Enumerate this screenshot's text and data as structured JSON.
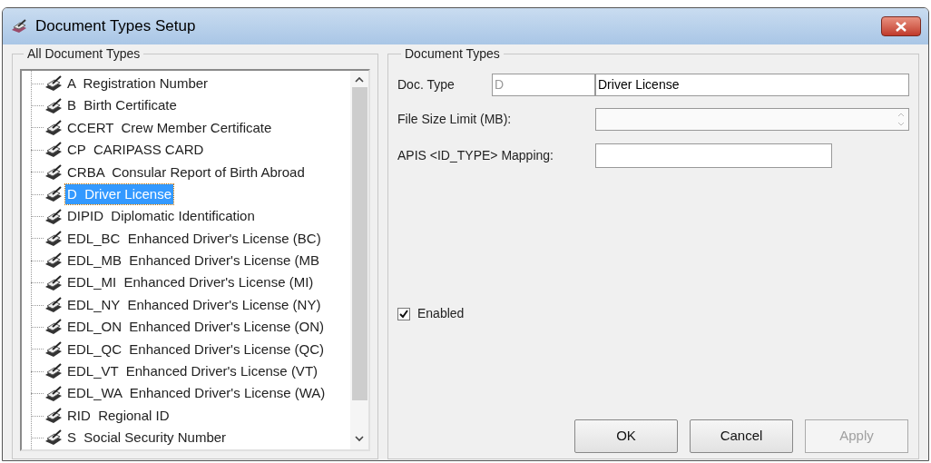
{
  "window": {
    "title": "Document Types Setup"
  },
  "all_document_types": {
    "title": "All Document Types",
    "items": [
      {
        "label": "A  Registration Number",
        "selected": false
      },
      {
        "label": "B  Birth Certificate",
        "selected": false
      },
      {
        "label": "CCERT  Crew Member Certificate",
        "selected": false
      },
      {
        "label": "CP  CARIPASS CARD",
        "selected": false
      },
      {
        "label": "CRBA  Consular Report of Birth Abroad",
        "selected": false
      },
      {
        "label": "D  Driver License",
        "selected": true
      },
      {
        "label": "DIPID  Diplomatic Identification",
        "selected": false
      },
      {
        "label": "EDL_BC  Enhanced Driver's License (BC)",
        "selected": false
      },
      {
        "label": "EDL_MB  Enhanced Driver's License (MB",
        "selected": false
      },
      {
        "label": "EDL_MI  Enhanced Driver's License (MI)",
        "selected": false
      },
      {
        "label": "EDL_NY  Enhanced Driver's License (NY)",
        "selected": false
      },
      {
        "label": "EDL_ON  Enhanced Driver's License (ON)",
        "selected": false
      },
      {
        "label": "EDL_QC  Enhanced Driver's License (QC)",
        "selected": false
      },
      {
        "label": "EDL_VT  Enhanced Driver's License (VT)",
        "selected": false
      },
      {
        "label": "EDL_WA  Enhanced Driver's License (WA)",
        "selected": false
      },
      {
        "label": "RID  Regional ID",
        "selected": false
      },
      {
        "label": "S  Social Security Number",
        "selected": false
      }
    ]
  },
  "document_types": {
    "title": "Document Types",
    "doc_type_label": "Doc. Type",
    "doc_type_code": {
      "value": "D",
      "disabled": true
    },
    "doc_type_name": {
      "value": "Driver License"
    },
    "file_size_label": "File Size Limit (MB):",
    "mapping_label": "APIS <ID_TYPE> Mapping:",
    "enabled": {
      "label": "Enabled",
      "checked": true
    }
  },
  "buttons": [
    {
      "label": "OK",
      "disabled": false
    },
    {
      "label": "Cancel",
      "disabled": false
    },
    {
      "label": "Apply",
      "disabled": true
    }
  ]
}
